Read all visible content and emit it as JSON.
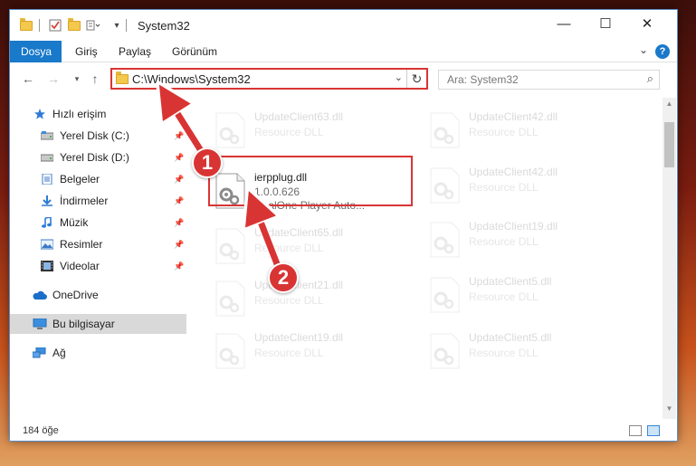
{
  "window": {
    "title": "System32"
  },
  "ribbon": {
    "tabs": [
      "Dosya",
      "Giriş",
      "Paylaş",
      "Görünüm"
    ],
    "help": "?"
  },
  "address": {
    "path": "C:\\Windows\\System32"
  },
  "search": {
    "placeholder": "Ara: System32"
  },
  "sidebar": {
    "items": [
      {
        "label": "Hızlı erişim",
        "icon": "star-icon"
      },
      {
        "label": "Yerel Disk (C:)",
        "icon": "drive-icon",
        "pinned": true
      },
      {
        "label": "Yerel Disk (D:)",
        "icon": "drive-icon",
        "pinned": true
      },
      {
        "label": "Belgeler",
        "icon": "documents-icon",
        "pinned": true
      },
      {
        "label": "İndirmeler",
        "icon": "download-icon",
        "pinned": true
      },
      {
        "label": "Müzik",
        "icon": "music-icon",
        "pinned": true
      },
      {
        "label": "Resimler",
        "icon": "pictures-icon",
        "pinned": true
      },
      {
        "label": "Videolar",
        "icon": "videos-icon",
        "pinned": true
      },
      {
        "label": "OneDrive",
        "icon": "cloud-icon"
      },
      {
        "label": "Bu bilgisayar",
        "icon": "computer-icon",
        "selected": true
      },
      {
        "label": "Ağ",
        "icon": "network-icon"
      }
    ]
  },
  "files": {
    "highlighted": {
      "name": "ierpplug.dll",
      "version": "1.0.0.626",
      "description": "RealOne Player Auto..."
    },
    "left_col": [
      {
        "name": "UpdateClient63.dll",
        "sub": "Resource DLL"
      },
      {
        "name": "UpdateClient65.dll",
        "sub": "Resource DLL"
      },
      {
        "name": "UpdateClient21.dll",
        "sub": "Resource DLL"
      },
      {
        "name": "UpdateClient19.dll",
        "sub": "Resource DLL"
      }
    ],
    "right_col": [
      {
        "name": "UpdateClient42.dll",
        "sub": "Resource DLL"
      },
      {
        "name": "UpdateClient42.dll",
        "sub": "Resource DLL"
      },
      {
        "name": "UpdateClient19.dll",
        "sub": "Resource DLL"
      },
      {
        "name": "UpdateClient5.dll",
        "sub": "Resource DLL"
      },
      {
        "name": "UpdateClient5.dll",
        "sub": "Resource DLL"
      }
    ]
  },
  "status": {
    "count": "184 öğe"
  },
  "annotations": {
    "step1": "1",
    "step2": "2",
    "color": "#d93434"
  }
}
